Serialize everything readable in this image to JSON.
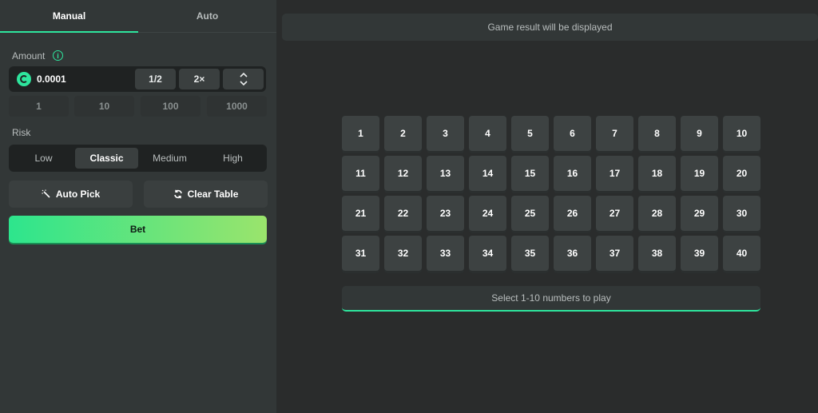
{
  "tabs": {
    "manual": "Manual",
    "auto": "Auto"
  },
  "amount": {
    "label": "Amount",
    "info_icon": "info-icon",
    "coin_icon": "coin-icon",
    "value": "0.0001",
    "half_label": "1/2",
    "double_label": "2×",
    "stepper_up": "⌃",
    "stepper_down": "⌄",
    "quick_values": [
      "1",
      "10",
      "100",
      "1000"
    ]
  },
  "risk": {
    "label": "Risk",
    "options": [
      "Low",
      "Classic",
      "Medium",
      "High"
    ],
    "selected": "Classic"
  },
  "actions": {
    "auto_pick": "Auto Pick",
    "auto_pick_icon": "magic-wand-icon",
    "clear_table": "Clear Table",
    "clear_table_icon": "refresh-icon"
  },
  "bet_label": "Bet",
  "result_text": "Game result will be displayed",
  "numbers": [
    "1",
    "2",
    "3",
    "4",
    "5",
    "6",
    "7",
    "8",
    "9",
    "10",
    "11",
    "12",
    "13",
    "14",
    "15",
    "16",
    "17",
    "18",
    "19",
    "20",
    "21",
    "22",
    "23",
    "24",
    "25",
    "26",
    "27",
    "28",
    "29",
    "30",
    "31",
    "32",
    "33",
    "34",
    "35",
    "36",
    "37",
    "38",
    "39",
    "40"
  ],
  "hint_text": "Select 1-10 numbers to play",
  "colors": {
    "accent": "#2ee59d",
    "bet_gradient_end": "#9ae46c",
    "panel": "#323737",
    "background": "#2a2c2c"
  }
}
